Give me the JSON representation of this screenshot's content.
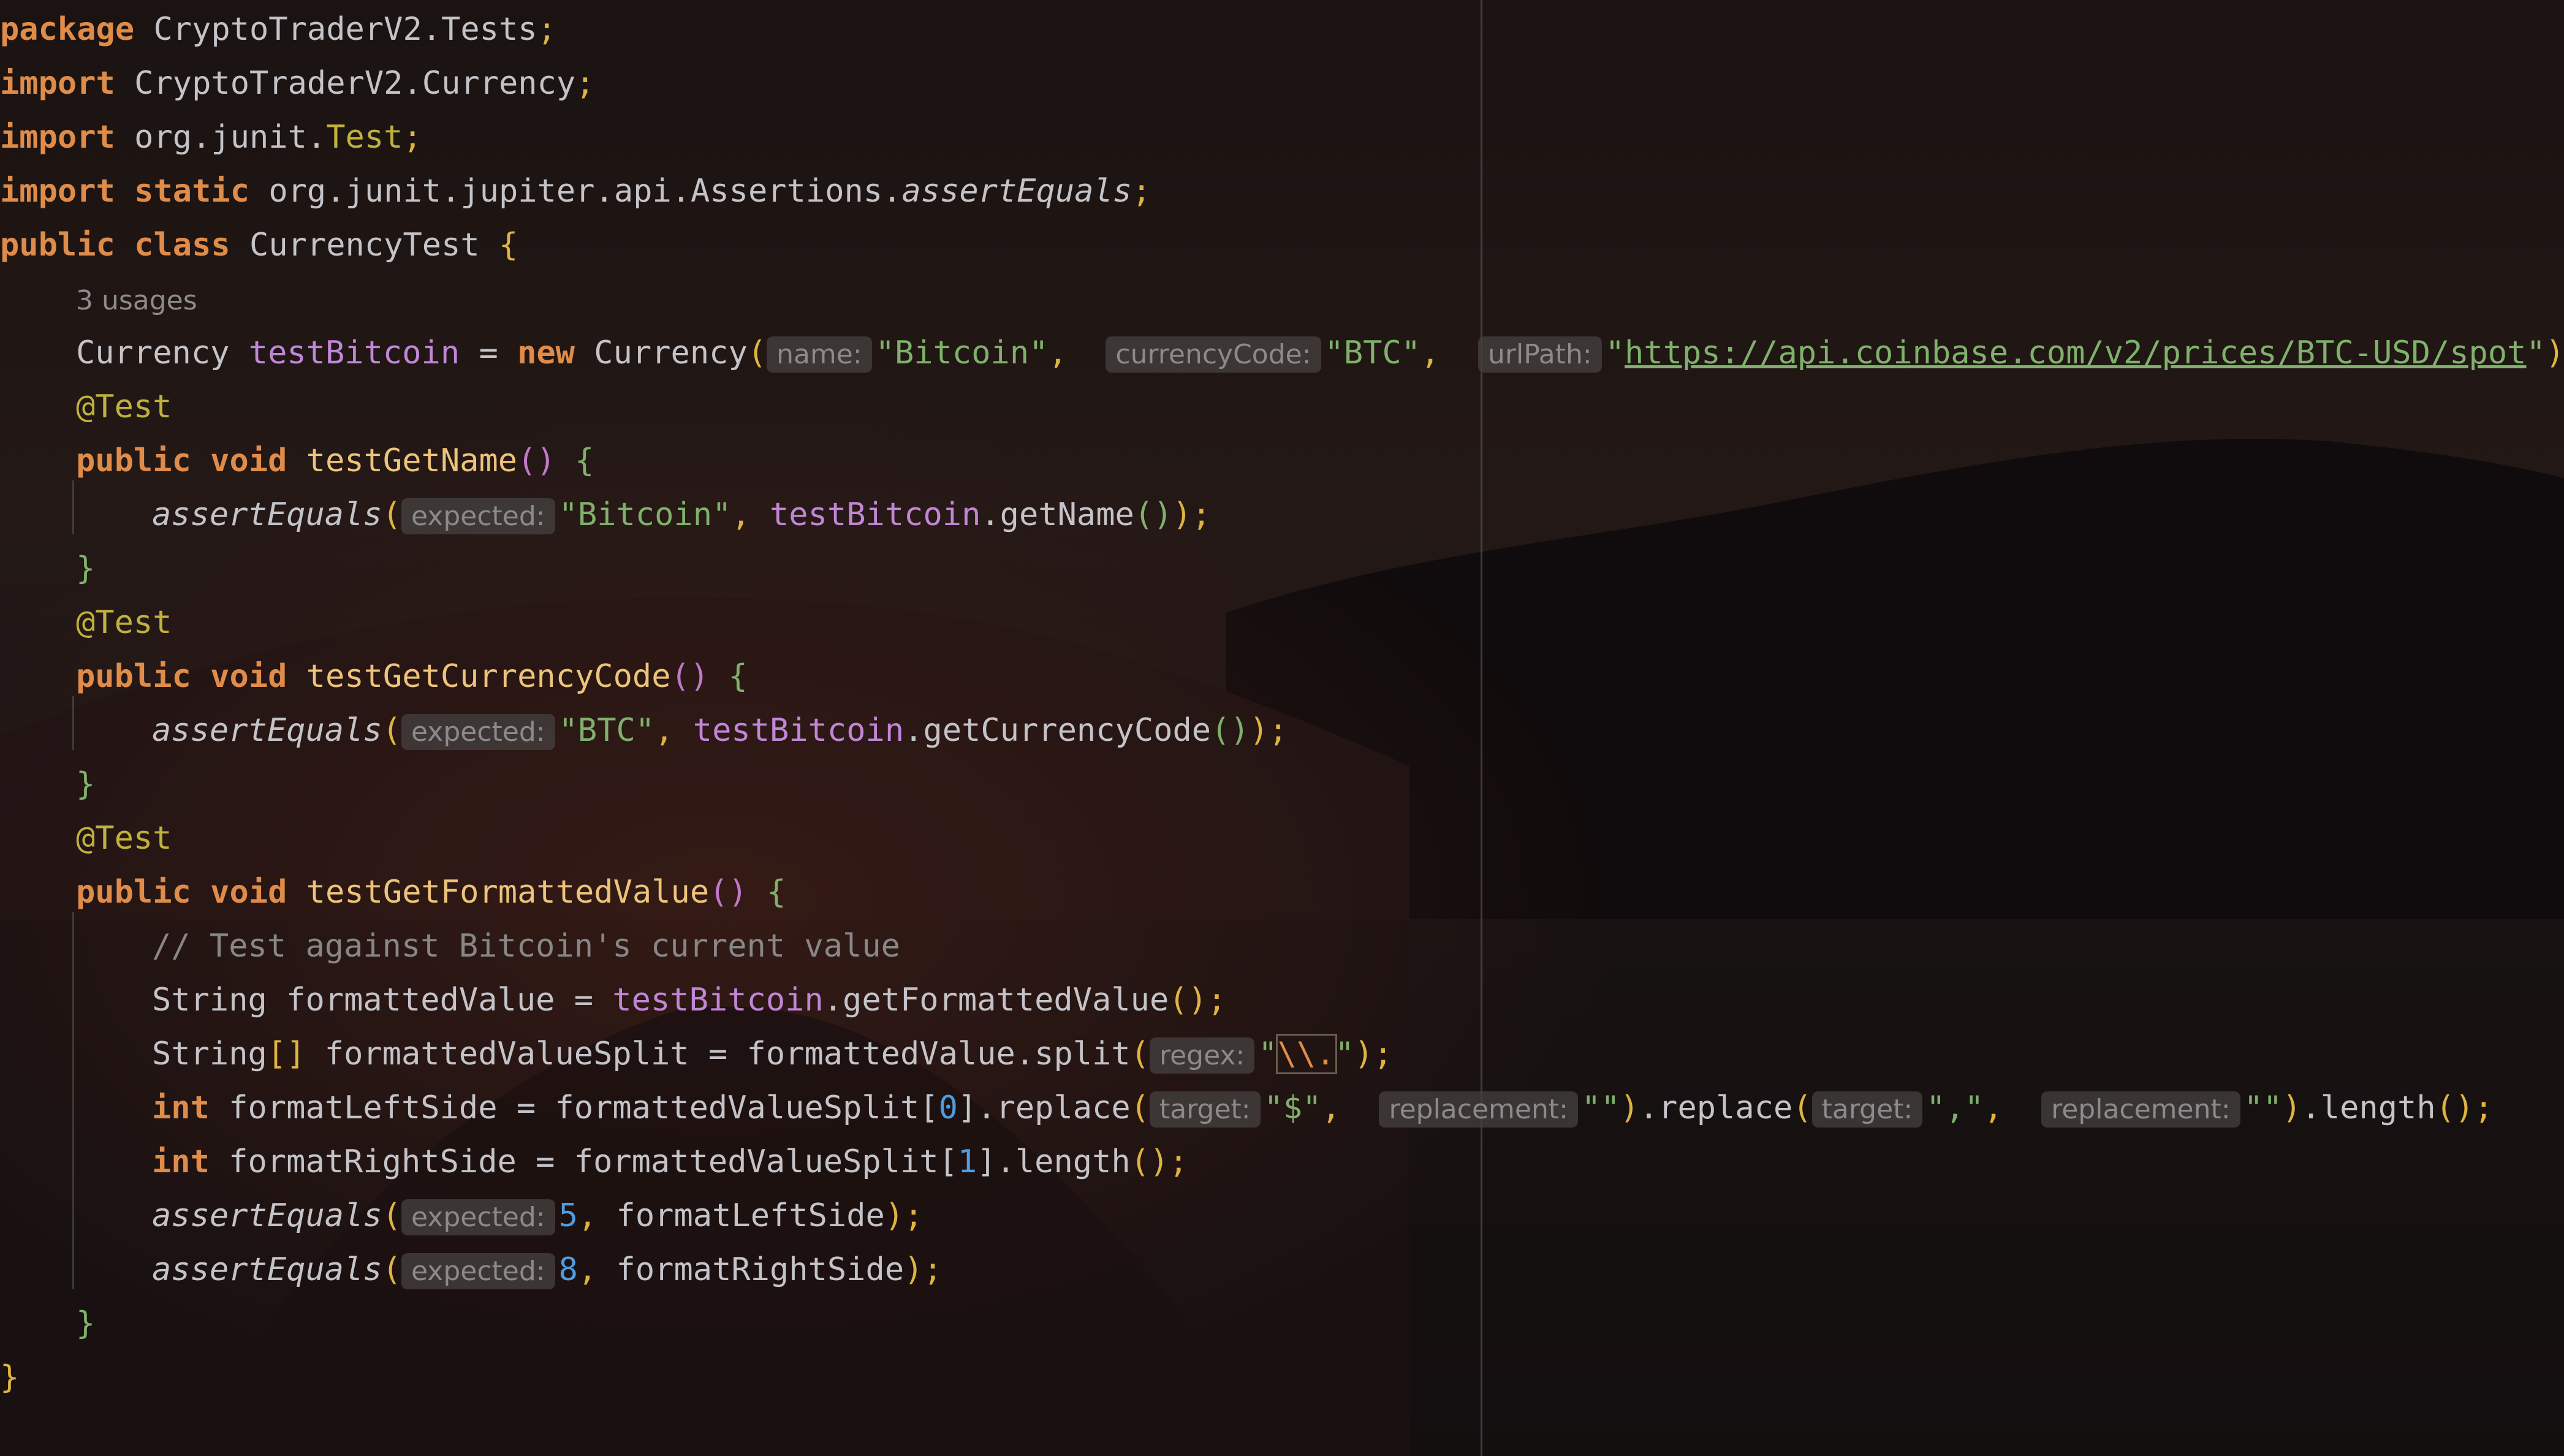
{
  "editor": {
    "file_language": "Java",
    "colors": {
      "keyword": "#df8c4a",
      "string": "#7fb16b",
      "function": "#ecc37a",
      "field": "#c186d6",
      "number": "#4f9de0",
      "comment": "#878787",
      "annotation": "#c0b13e"
    },
    "lines": {
      "l1": {
        "kw": "package",
        "pkg": "CryptoTraderV2.Tests",
        "semi": ";"
      },
      "l2": {
        "kw": "import",
        "pkg": "CryptoTraderV2.Currency",
        "semi": ";"
      },
      "l3": {
        "kw": "import",
        "pkg": "org.junit.",
        "cls": "Test",
        "semi": ";"
      },
      "l4": {
        "kw1": "import",
        "kw2": "static",
        "pkg": "org.junit.jupiter.api.Assertions.",
        "method": "assertEquals",
        "semi": ";"
      },
      "l5": {
        "kw1": "public",
        "kw2": "class",
        "name": "CurrencyTest",
        "brace": "{"
      },
      "usages": "3 usages",
      "l6": {
        "type": "Currency",
        "field": "testBitcoin",
        "eq": " = ",
        "kw": "new",
        "ctor": "Currency",
        "hint_name": "name:",
        "arg_name": "\"Bitcoin\"",
        "hint_code": "currencyCode:",
        "arg_code": "\"BTC\"",
        "hint_url": "urlPath:",
        "arg_url": "https://api.coinbase.com/v2/prices/BTC-USD/spot",
        "end": ");"
      },
      "ann": "@Test",
      "m1": {
        "kw1": "public",
        "kw2": "void",
        "name": "testGetName",
        "paren": "()",
        "brace": "{"
      },
      "m1b": {
        "call": "assertEquals",
        "hint": "expected:",
        "arg": "\"Bitcoin\"",
        "field": "testBitcoin",
        "getter": ".getName",
        "end": ");"
      },
      "close": "}",
      "m2": {
        "kw1": "public",
        "kw2": "void",
        "name": "testGetCurrencyCode",
        "paren": "()",
        "brace": "{"
      },
      "m2b": {
        "call": "assertEquals",
        "hint": "expected:",
        "arg": "\"BTC\"",
        "field": "testBitcoin",
        "getter": ".getCurrencyCode",
        "end": ");"
      },
      "m3": {
        "kw1": "public",
        "kw2": "void",
        "name": "testGetFormattedValue",
        "paren": "()",
        "brace": "{"
      },
      "m3c": "// Test against Bitcoin's current value",
      "m3l1": {
        "type": "String",
        "var": "formattedValue",
        "eq": " = ",
        "field": "testBitcoin",
        "getter": ".getFormattedValue",
        "end": ";"
      },
      "m3l2": {
        "type": "String",
        "arr": "[]",
        "var": "formattedValueSplit",
        "eq": " = ",
        "src": "formattedValue",
        "call": ".split",
        "hint": "regex:",
        "q1": "\"",
        "esc": "\\\\.",
        "q2": "\"",
        "end": ");"
      },
      "m3l3": {
        "kw": "int",
        "var": "formatLeftSide",
        "eq": " = ",
        "src": "formattedValueSplit",
        "idx": "0",
        "call1": ".replace",
        "hint_t1": "target:",
        "arg_t1": "\"$\"",
        "hint_r1": "replacement:",
        "arg_r1": "\"\"",
        "call2": ".replace",
        "hint_t2": "target:",
        "arg_t2": "\",\"",
        "hint_r2": "replacement:",
        "arg_r2": "\"\"",
        "tail": ".length",
        "end": ";"
      },
      "m3l4": {
        "kw": "int",
        "var": "formatRightSide",
        "eq": " = ",
        "src": "formattedValueSplit",
        "idx": "1",
        "tail": ".length",
        "end": ";"
      },
      "m3l5": {
        "call": "assertEquals",
        "hint": "expected:",
        "num": "5",
        "arg": "formatLeftSide",
        "end": ");"
      },
      "m3l6": {
        "call": "assertEquals",
        "hint": "expected:",
        "num": "8",
        "arg": "formatRightSide",
        "end": ");"
      }
    }
  }
}
